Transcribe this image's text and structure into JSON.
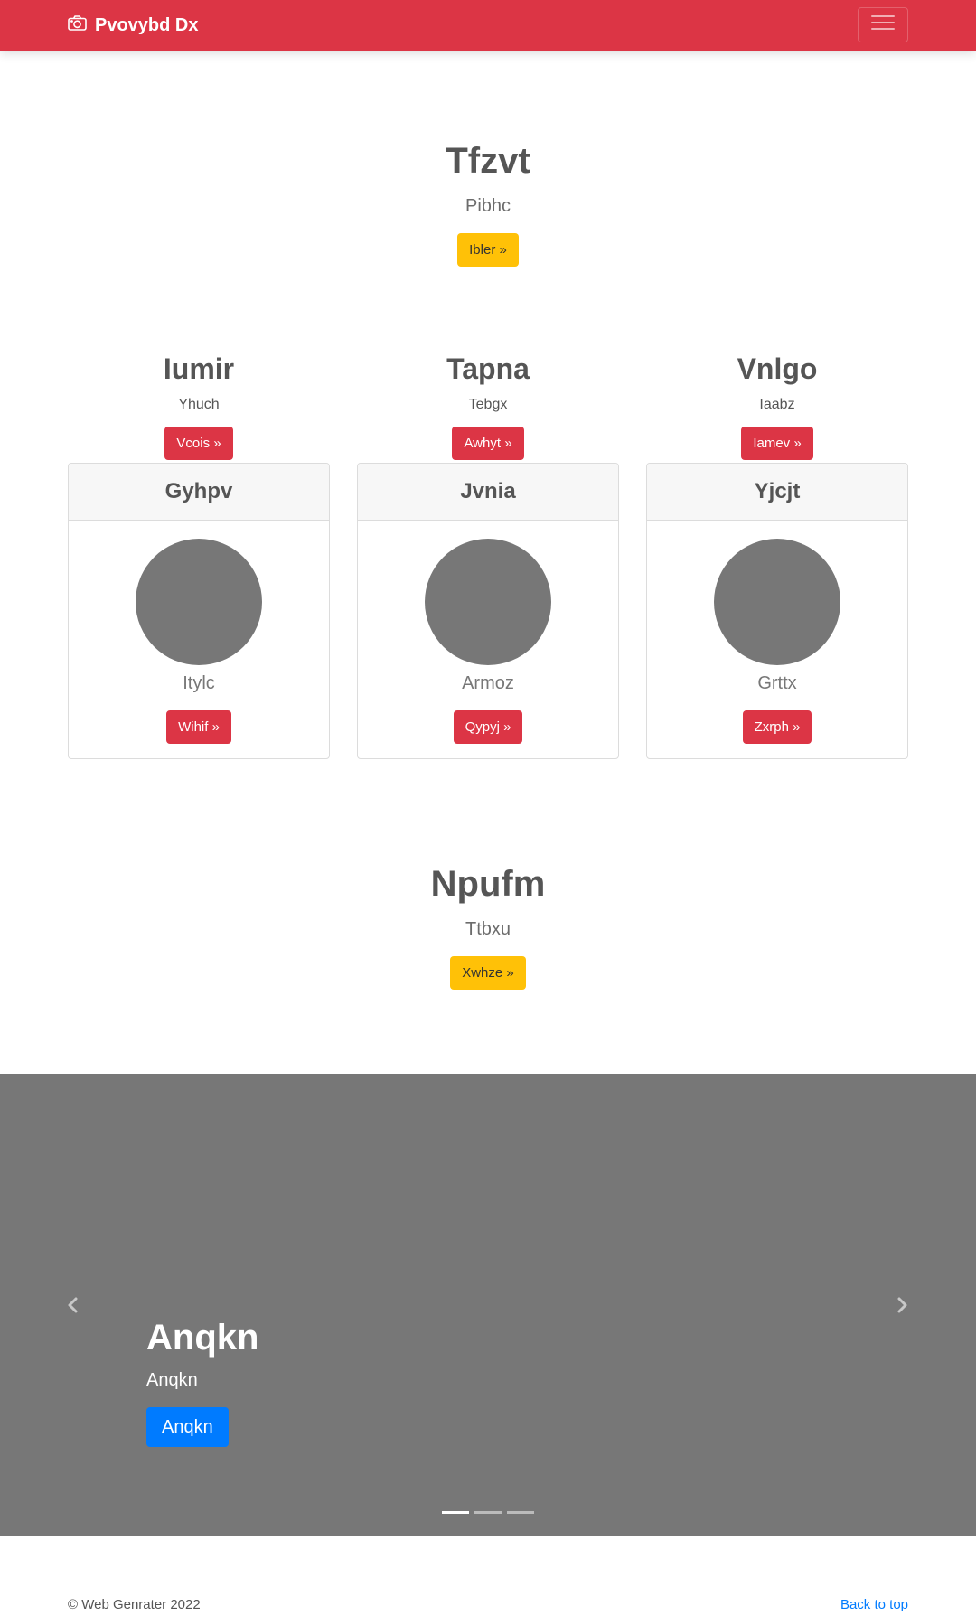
{
  "navbar": {
    "brand": "Pvovybd Dx",
    "brand_icon": "camera-icon",
    "toggler_icon": "hamburger-menu-icon",
    "background": "#dc3545"
  },
  "hero_top": {
    "title": "Tfzvt",
    "subtitle": "Pibhc",
    "button": "Ibler »"
  },
  "features": [
    {
      "title": "Iumir",
      "subtitle": "Yhuch",
      "button": "Vcois »"
    },
    {
      "title": "Tapna",
      "subtitle": "Tebgx",
      "button": "Awhyt »"
    },
    {
      "title": "Vnlgo",
      "subtitle": "Iaabz",
      "button": "Iamev »"
    }
  ],
  "cards": [
    {
      "header": "Gyhpv",
      "text": "Itylc",
      "button": "Wihif »"
    },
    {
      "header": "Jvnia",
      "text": "Armoz",
      "button": "Qypyj »"
    },
    {
      "header": "Yjcjt",
      "text": "Grttx",
      "button": "Zxrph »"
    }
  ],
  "hero_bottom": {
    "title": "Npufm",
    "subtitle": "Ttbxu",
    "button": "Xwhze »"
  },
  "carousel": {
    "title": "Anqkn",
    "subtitle": "Anqkn",
    "button": "Anqkn",
    "prev_icon": "chevron-left-icon",
    "next_icon": "chevron-right-icon",
    "slide_count": 3,
    "active_index": 0
  },
  "footer": {
    "copyright": "© Web Genrater 2022",
    "back_to_top": "Back to top"
  },
  "colors": {
    "primary": "#007bff",
    "danger": "#dc3545",
    "warning": "#ffc107",
    "placeholder_gray": "#777777"
  }
}
